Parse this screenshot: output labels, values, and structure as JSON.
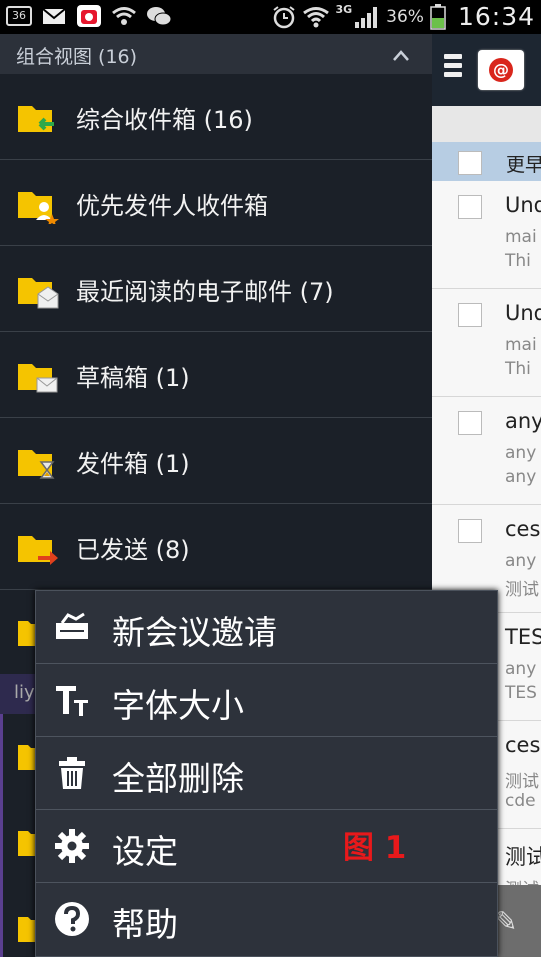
{
  "status_bar": {
    "notification_count": "36",
    "network_type": "3G",
    "battery_percent": "36%",
    "time": "16:34",
    "icons": [
      "notification-count-badge",
      "email-icon",
      "sina-weibo-icon",
      "wifi-icon",
      "wechat-icon",
      "alarm-icon",
      "wifi-signal-icon",
      "cell-signal-icon",
      "battery-icon"
    ]
  },
  "drawer": {
    "header_title": "组合视图 (16)",
    "folders": [
      {
        "label": "综合收件箱 (16)",
        "icon": "inbox-folder-icon"
      },
      {
        "label": "优先发件人收件箱",
        "icon": "priority-sender-folder-icon"
      },
      {
        "label": "最近阅读的电子邮件 (7)",
        "icon": "recently-read-folder-icon"
      },
      {
        "label": "草稿箱 (1)",
        "icon": "drafts-folder-icon"
      },
      {
        "label": "发件箱 (1)",
        "icon": "outbox-folder-icon"
      },
      {
        "label": "已发送 (8)",
        "icon": "sent-folder-icon"
      }
    ],
    "account_partial": "liy"
  },
  "mail_list": {
    "selection_bar_partial": "更早",
    "items": [
      {
        "line1": "Und",
        "line2": "mai",
        "line3": "Thi"
      },
      {
        "line1": "Und",
        "line2": "mai",
        "line3": "Thi"
      },
      {
        "line1": "any",
        "line2": "any",
        "line3": "any"
      },
      {
        "line1": "ces",
        "line2": "any",
        "line3": "测试"
      },
      {
        "line1": "TES",
        "line2": "any",
        "line3": "TES"
      },
      {
        "line1": "ces",
        "line2": "测试",
        "line3": "cde"
      },
      {
        "line1": "测试",
        "line2": "测试",
        "line3": ""
      }
    ]
  },
  "menu": {
    "items": [
      {
        "label": "新会议邀请",
        "icon": "meeting-invite-icon"
      },
      {
        "label": "字体大小",
        "icon": "font-size-icon"
      },
      {
        "label": "全部删除",
        "icon": "trash-icon"
      },
      {
        "label": "设定",
        "icon": "gear-icon"
      },
      {
        "label": "帮助",
        "icon": "help-icon"
      }
    ]
  },
  "annotation": "图 1",
  "colors": {
    "drawer_bg": "#1b2028",
    "menu_bg": "#2d323b",
    "folder_yellow": "#f5c400",
    "annotation_red": "#e8191b"
  }
}
